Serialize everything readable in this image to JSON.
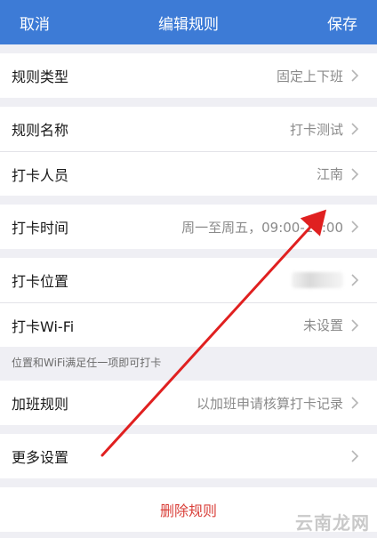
{
  "navbar": {
    "cancel": "取消",
    "title": "编辑规则",
    "save": "保存"
  },
  "rules": [
    {
      "label": "规则类型",
      "value": "固定上下班"
    }
  ],
  "group2": [
    {
      "label": "规则名称",
      "value": "打卡测试"
    },
    {
      "label": "打卡人员",
      "value": "江南"
    }
  ],
  "group3": [
    {
      "label": "打卡时间",
      "value": "周一至周五，09:00-17:00"
    }
  ],
  "group4": [
    {
      "label": "打卡位置",
      "value": ""
    },
    {
      "label": "打卡Wi-Fi",
      "value": "未设置"
    }
  ],
  "hint": "位置和WiFi满足任一项即可打卡",
  "group5": [
    {
      "label": "加班规则",
      "value": "以加班申请核算打卡记录"
    }
  ],
  "group6": [
    {
      "label": "更多设置",
      "value": ""
    }
  ],
  "delete_label": "删除规则",
  "watermark": "云南龙网",
  "colors": {
    "navbar": "#3d7bd6",
    "delete": "#d9403a",
    "arrow": "#e02020"
  }
}
